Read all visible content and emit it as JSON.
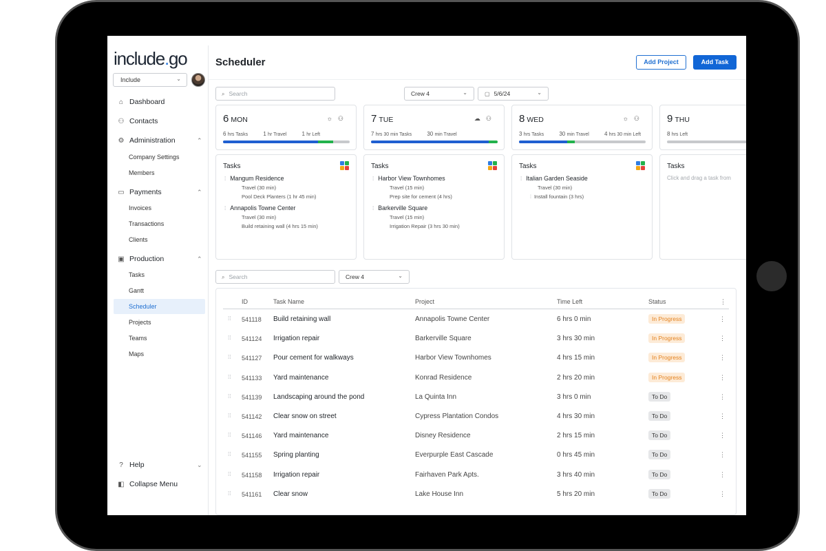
{
  "app": {
    "logo_main": "include",
    "logo_dot": ".",
    "logo_suffix": "go"
  },
  "org_select": {
    "value": "Include"
  },
  "nav": {
    "dashboard": "Dashboard",
    "contacts": "Contacts",
    "administration": "Administration",
    "administration_items": [
      "Company Settings",
      "Members"
    ],
    "payments": "Payments",
    "payments_items": [
      "Invoices",
      "Transactions",
      "Clients"
    ],
    "production": "Production",
    "production_items": [
      "Tasks",
      "Gantt",
      "Scheduler",
      "Projects",
      "Teams",
      "Maps"
    ],
    "help": "Help",
    "collapse": "Collapse Menu"
  },
  "header": {
    "title": "Scheduler",
    "add_project": "Add Project",
    "add_task": "Add Task"
  },
  "filters": {
    "search_placeholder": "Search",
    "crew": "Crew 4",
    "date": "5/6/24"
  },
  "days": [
    {
      "num": "6",
      "dow": "MON",
      "stats": [
        [
          "6",
          "hrs Tasks"
        ],
        [
          "1",
          "hr Travel"
        ],
        [
          "1",
          "hr Left"
        ]
      ],
      "progress_blue": 0.75,
      "progress_green": 0.12
    },
    {
      "num": "7",
      "dow": "TUE",
      "stats": [
        [
          "7",
          "hrs 30 min Tasks"
        ],
        [
          "30",
          "min Travel"
        ]
      ],
      "progress_blue": 0.93,
      "progress_green": 0.07
    },
    {
      "num": "8",
      "dow": "WED",
      "stats": [
        [
          "3",
          "hrs Tasks"
        ],
        [
          "30",
          "min Travel"
        ],
        [
          "4",
          "hrs 30 min Left"
        ]
      ],
      "progress_blue": 0.38,
      "progress_green": 0.06
    },
    {
      "num": "9",
      "dow": "THU",
      "stats": [
        [
          "8",
          "hrs Left"
        ]
      ],
      "progress_blue": 0,
      "progress_green": 0
    }
  ],
  "task_cards": {
    "title": "Tasks",
    "placeholder": "Click and drag a task from",
    "mon": [
      {
        "project": "Mangum Residence",
        "lines": [
          "Travel (30 min)",
          "Pool Deck Planters (1 hr 45 min)"
        ]
      },
      {
        "project": "Annapolis Towne Center",
        "lines": [
          "Travel (30 min)",
          "Build retaining wall (4 hrs 15 min)"
        ]
      }
    ],
    "tue": [
      {
        "project": "Harbor View Townhomes",
        "lines": [
          "Travel (15 min)",
          "Prep site for cement (4 hrs)"
        ]
      },
      {
        "project": "Barkerville Square",
        "lines": [
          "Travel (15 min)",
          "Irrigation Repair (3 hrs 30 min)"
        ]
      }
    ],
    "wed": [
      {
        "project": "Italian Garden Seaside",
        "lines": [
          "Travel (30 min)",
          "Install fountain (3 hrs)"
        ]
      }
    ]
  },
  "table": {
    "headers": {
      "id": "ID",
      "name": "Task Name",
      "project": "Project",
      "time": "Time Left",
      "status": "Status",
      "more": "⋮"
    },
    "rows": [
      {
        "id": "541118",
        "name": "Build retaining wall",
        "project": "Annapolis Towne Center",
        "time": "6 hrs 0 min",
        "status": "In Progress"
      },
      {
        "id": "541124",
        "name": "Irrigation repair",
        "project": "Barkerville Square",
        "time": "3 hrs 30 min",
        "status": "In Progress"
      },
      {
        "id": "541127",
        "name": "Pour cement for walkways",
        "project": "Harbor View Townhomes",
        "time": "4 hrs 15 min",
        "status": "In Progress"
      },
      {
        "id": "541133",
        "name": "Yard maintenance",
        "project": "Konrad Residence",
        "time": "2 hrs 20 min",
        "status": "In Progress"
      },
      {
        "id": "541139",
        "name": "Landscaping around the pond",
        "project": "La Quinta Inn",
        "time": "3 hrs 0 min",
        "status": "To Do"
      },
      {
        "id": "541142",
        "name": "Clear snow on street",
        "project": "Cypress Plantation Condos",
        "time": "4 hrs 30 min",
        "status": "To Do"
      },
      {
        "id": "541146",
        "name": "Yard maintenance",
        "project": "Disney Residence",
        "time": "2 hrs 15 min",
        "status": "To Do"
      },
      {
        "id": "541155",
        "name": "Spring planting",
        "project": "Everpurple East Cascade",
        "time": "0 hrs 45 min",
        "status": "To Do"
      },
      {
        "id": "541158",
        "name": "Irrigation repair",
        "project": "Fairhaven Park Apts.",
        "time": "3 hrs 40 min",
        "status": "To Do"
      },
      {
        "id": "541161",
        "name": "Clear snow",
        "project": "Lake House Inn",
        "time": "5 hrs 20 min",
        "status": "To Do"
      }
    ]
  },
  "colors": {
    "accent": "#1166d6",
    "progress_blue": "#1f5fd1",
    "progress_green": "#22b24c",
    "in_progress_bg": "#fdebd7",
    "in_progress_text": "#e3821f",
    "todo_bg": "#e6e7e9"
  }
}
